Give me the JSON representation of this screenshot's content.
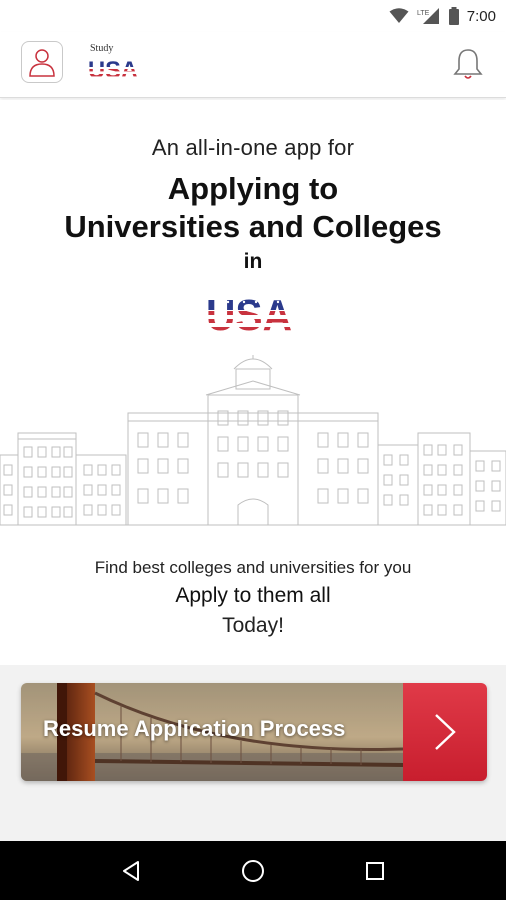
{
  "status_bar": {
    "time": "7:00",
    "network_label": "LTE",
    "icons": [
      "wifi-icon",
      "cell-signal-icon",
      "battery-icon"
    ]
  },
  "header": {
    "logo_small_text": "Study",
    "logo_word": "USA",
    "icons": [
      "user-profile-icon",
      "notification-bell-icon"
    ]
  },
  "hero": {
    "tagline": "An all-in-one app for",
    "headline_line1": "Applying to",
    "headline_line2": "Universities and Colleges",
    "in_text": "in",
    "usa_word": "USA",
    "find_text": "Find best colleges and universities for you",
    "apply_text": "Apply to them all",
    "today_text": "Today!"
  },
  "resume": {
    "label": "Resume Application Process",
    "arrow_icon": "chevron-right-icon"
  },
  "nav": {
    "icons": [
      "back-icon",
      "home-icon",
      "recents-icon"
    ]
  },
  "colors": {
    "accent_red": "#c81e2e",
    "flag_blue": "#2b3a8c",
    "nav_bg": "#000000",
    "bottom_bg": "#f2f2f2"
  }
}
